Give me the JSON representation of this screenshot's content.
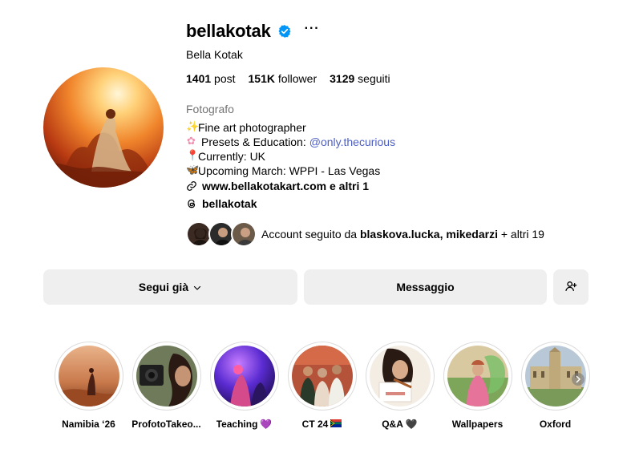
{
  "profile": {
    "username": "bellakotak",
    "full_name": "Bella Kotak",
    "more_label": "···",
    "stats": {
      "posts_value": "1401",
      "posts_label": "post",
      "followers_value": "151K",
      "followers_label": "follower",
      "following_value": "3129",
      "following_label": "seguiti"
    },
    "category": "Fotografo",
    "bio": [
      {
        "emoji": "sparkles-icon",
        "text": "Fine art photographer"
      },
      {
        "emoji": "flower-icon",
        "text": "Presets & Education:",
        "mention": "@only.thecurious"
      },
      {
        "emoji": "pin-icon",
        "text": "Currently: UK"
      },
      {
        "emoji": "butterfly-icon",
        "text": "Upcoming March: WPPI - Las Vegas"
      }
    ],
    "link_text": "www.bellakotakart.com e altri 1",
    "threads_handle": "bellakotak",
    "mutuals": {
      "prefix": "Account seguito da",
      "names": "blaskova.lucka, mikedarzi",
      "suffix": "+ altri 19"
    }
  },
  "actions": {
    "follow_label": "Segui già",
    "message_label": "Messaggio"
  },
  "highlights": [
    {
      "label": "Namibia ‘26",
      "emoji": ""
    },
    {
      "label": "ProfotoTakeo...",
      "emoji": ""
    },
    {
      "label": "Teaching",
      "emoji": "💜"
    },
    {
      "label": "CT 24",
      "emoji": "🇿🇦"
    },
    {
      "label": "Q&A",
      "emoji": "🖤"
    },
    {
      "label": "Wallpapers",
      "emoji": ""
    },
    {
      "label": "Oxford",
      "emoji": ""
    }
  ],
  "colors": {
    "accent_link": "#4c5ec7",
    "verified": "#0095f6",
    "button_bg": "#efefef",
    "muted_text": "#737373"
  }
}
